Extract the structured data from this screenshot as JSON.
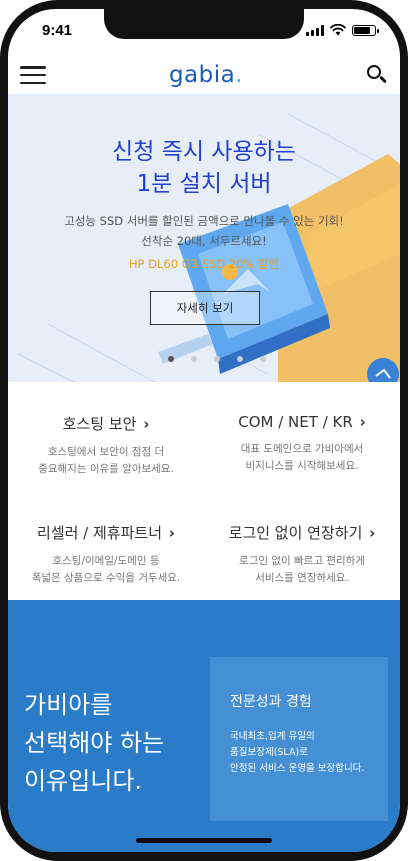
{
  "status_bar": {
    "time": "9:41",
    "battery_level": 0.85
  },
  "header": {
    "logo_text": "gabia",
    "logo_dot": "."
  },
  "hero": {
    "title_lines": [
      "신청 즉시 사용하는",
      "1분 설치 서버"
    ],
    "subtitle_lines": [
      "고성능 SSD 서버를 할인된 금액으로 만나볼 수 있는 기회!",
      "선착순 20대, 서두르세요!"
    ],
    "promo": "HP DL60 G3 SSD 20% 할인",
    "button_label": "자세히 보기",
    "slides": 5,
    "active_slide": 0
  },
  "services": [
    {
      "title": "호스팅 보안",
      "desc_lines": [
        "호스팅에서 보안이 점점 더",
        "중요해지는 이유를 알아보세요."
      ]
    },
    {
      "title": "COM / NET / KR",
      "desc_lines": [
        "대표 도메인으로 가비아에서",
        "비지니스를 시작해보세요."
      ]
    },
    {
      "title": "리셀러 / 제휴파트너",
      "desc_lines": [
        "호스팅/이메일/도메인 등",
        "폭넓은 상품으로 수익을 거두세요."
      ]
    },
    {
      "title": "로그인 없이 연장하기",
      "desc_lines": [
        "로그인 없이 빠르고 편리하게",
        "서비스를 연장하세요."
      ]
    }
  ],
  "why": {
    "headline_lines": [
      "가비아를",
      "선택해야 하는",
      "이유입니다."
    ],
    "card_title": "전문성과 경험",
    "card_desc_lines": [
      "국내최초,업계 유일의",
      "품질보장제(SLA)로",
      "안정된 서비스 운영을 보장합니다."
    ]
  },
  "colors": {
    "brand_blue": "#1a5cc0",
    "hero_title": "#2340d0",
    "promo": "#e8a020",
    "why_bg": "#2a7cc9",
    "why_card": "#4590d4"
  }
}
